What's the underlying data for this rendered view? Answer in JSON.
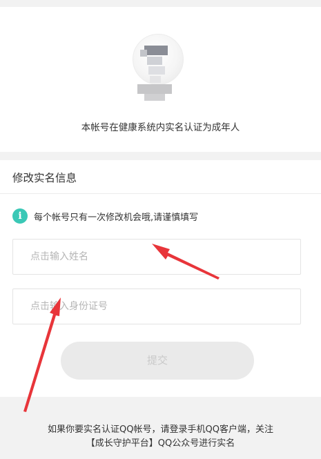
{
  "profile": {
    "status_text": "本帐号在健康系统内实名认证为成年人"
  },
  "form": {
    "section_title": "修改实名信息",
    "notice_icon": "i",
    "notice_text": "每个帐号只有一次修改机会哦,请谨慎填写",
    "name_input": {
      "placeholder": "点击输入姓名",
      "value": ""
    },
    "id_input": {
      "placeholder": "点击输入身份证号",
      "value": ""
    },
    "submit_label": "提交"
  },
  "footer": {
    "line1": "如果你要实名认证QQ帐号，请登录手机QQ客户端，关注",
    "line2": "【成长守护平台】QQ公众号进行实名"
  },
  "colors": {
    "accent_teal": "#3ac8b6",
    "annotation_red": "#e8353a",
    "page_bg": "#f2f2f2"
  },
  "icons": {
    "notice": "info-icon",
    "avatar": "avatar-icon"
  }
}
